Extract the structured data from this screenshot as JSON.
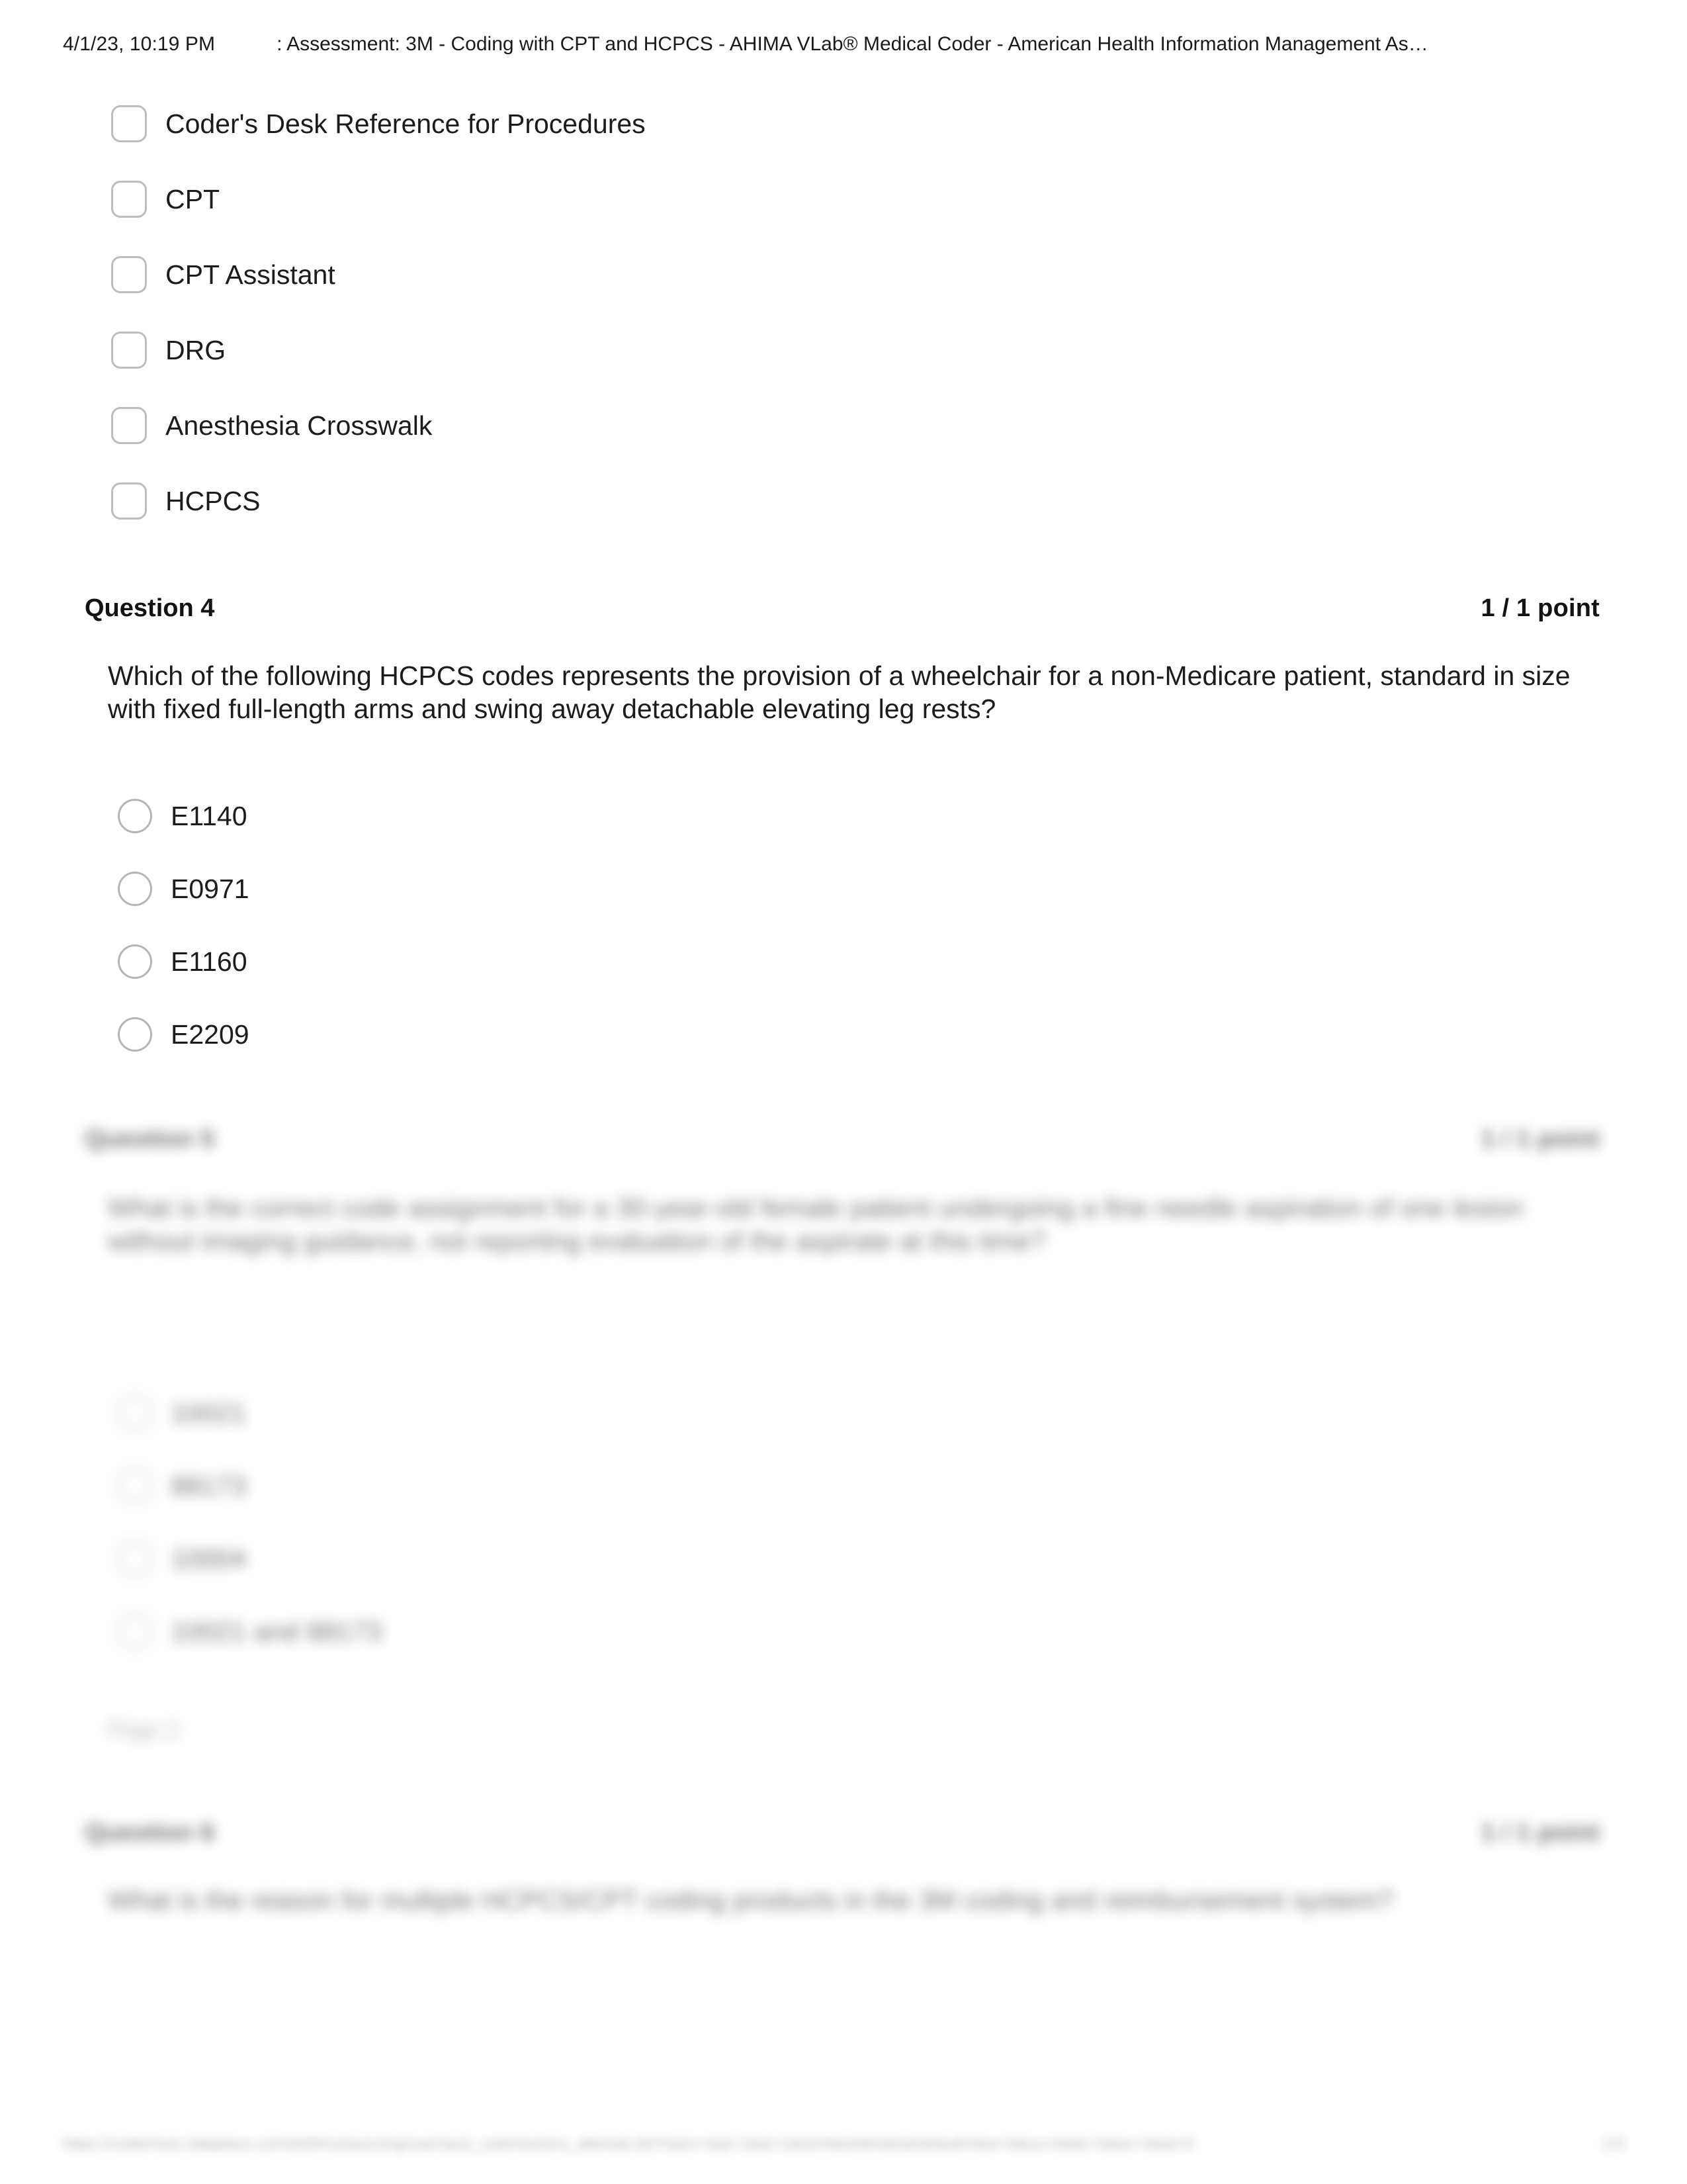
{
  "print_header": {
    "timestamp": "4/1/23, 10:19 PM",
    "document_title": ": Assessment: 3M - Coding with CPT and HCPCS - AHIMA VLab® Medical Coder - American Health Information Management As…"
  },
  "previous_question_choices": {
    "input_type": "checkbox",
    "items": [
      {
        "label": "Coder's Desk Reference for Procedures",
        "checked": false
      },
      {
        "label": "CPT",
        "checked": false
      },
      {
        "label": "CPT Assistant",
        "checked": false
      },
      {
        "label": "DRG",
        "checked": false
      },
      {
        "label": "Anesthesia Crosswalk",
        "checked": false
      },
      {
        "label": "HCPCS",
        "checked": false
      }
    ]
  },
  "question_4": {
    "heading": "Question 4",
    "points": "1 / 1 point",
    "prompt": "Which of the following HCPCS codes represents the provision of a wheelchair for a non-Medicare patient, standard in size with fixed full-length arms and swing away detachable elevating leg rests?",
    "input_type": "radio",
    "options": [
      {
        "label": "E1140",
        "selected": false
      },
      {
        "label": "E0971",
        "selected": false
      },
      {
        "label": "E1160",
        "selected": false
      },
      {
        "label": "E2209",
        "selected": false
      }
    ]
  },
  "question_5": {
    "blurred": true,
    "heading": "Question 5",
    "points": "1 / 1 point",
    "prompt": "What is the correct code assignment for a 30-year-old female patient undergoing a fine needle aspiration of one lesion without imaging guidance, not reporting evaluation of the aspirate at this time?",
    "input_type": "radio",
    "options": [
      {
        "label": "10021",
        "selected": false
      },
      {
        "label": "88173",
        "selected": false
      },
      {
        "label": "10004",
        "selected": false
      },
      {
        "label": "10021 and 88173",
        "selected": false
      }
    ],
    "page_note": "Page 2"
  },
  "question_6": {
    "blurred": true,
    "heading": "Question 6",
    "points": "1 / 1 point",
    "prompt": "What is the reason for multiple HCPCS/CPT coding products in the 3M coding and reimbursement system?"
  },
  "print_footer": {
    "url": "https://coderhost.vlabplace.com/d2l/lms/quizzing/user/quiz_submissions_attempt.d2l?isprv=&qi=1&ai=1&isInNewWindowDefaultView=0&ou=0&dc=0&ec=0&ai=0",
    "page_number": "1/3"
  }
}
